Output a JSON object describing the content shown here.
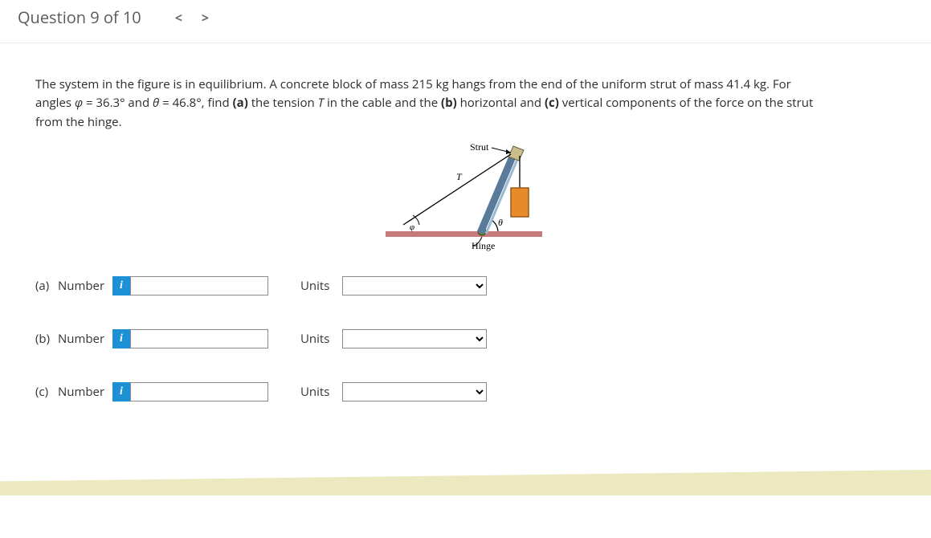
{
  "header": {
    "title": "Question 9 of 10",
    "prev_glyph": "<",
    "next_glyph": ">"
  },
  "problem": {
    "pre_phi": "The system in the figure is in equilibrium. A concrete block of mass 215 kg hangs from the end of the uniform strut of mass 41.4 kg. For angles ",
    "phi_sym": "φ",
    "mid1": " = 36.3° and ",
    "theta_sym": "θ",
    "mid2": " = 46.8°, find ",
    "bold_a": "(a)",
    "mid3": " the tension ",
    "t_sym": "T",
    "mid4": " in the cable and the ",
    "bold_b": "(b)",
    "mid5": " horizontal and ",
    "bold_c": "(c)",
    "mid6": " vertical components of the force on the strut from the hinge."
  },
  "figure": {
    "strut_label": "Strut",
    "t_label": "T",
    "phi_label": "φ",
    "theta_label": "θ",
    "hinge_label": "Hinge"
  },
  "answers": {
    "number_label": "Number",
    "units_label": "Units",
    "info_glyph": "i",
    "parts": [
      {
        "label": "(a)"
      },
      {
        "label": "(b)"
      },
      {
        "label": "(c)"
      }
    ]
  }
}
